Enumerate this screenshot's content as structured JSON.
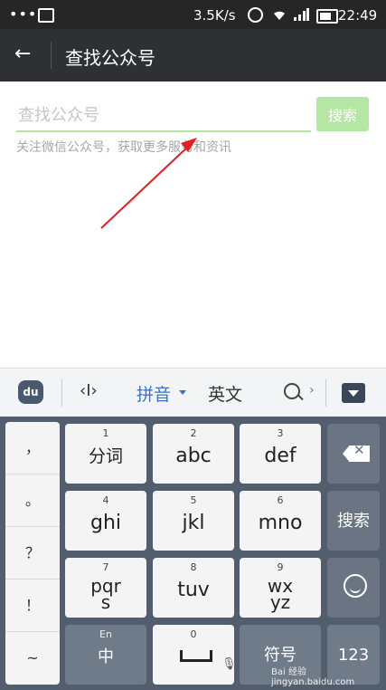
{
  "status_bar": {
    "dots": "•••",
    "speed": "3.5K/s",
    "time": "22:49"
  },
  "app_bar": {
    "back_icon": "←",
    "title": "查找公众号"
  },
  "search": {
    "placeholder": "查找公众号",
    "button_label": "搜索",
    "hint": "关注微信公众号，获取更多服务和资讯",
    "accent_color": "#b4e6a4"
  },
  "ime_toolbar": {
    "logo": "du",
    "cursor_icon": "‹I›",
    "pinyin_label": "拼音",
    "english_label": "英文",
    "more_icon": "›"
  },
  "keyboard": {
    "punctuation": [
      "，",
      "。",
      "？",
      "！",
      "~"
    ],
    "keys": [
      {
        "num": "1",
        "label": "分词"
      },
      {
        "num": "2",
        "label": "abc"
      },
      {
        "num": "3",
        "label": "def"
      },
      {
        "num": "4",
        "label": "ghi"
      },
      {
        "num": "5",
        "label": "jkl"
      },
      {
        "num": "6",
        "label": "mno"
      },
      {
        "num": "7",
        "label": "pqrs"
      },
      {
        "num": "8",
        "label": "tuv"
      },
      {
        "num": "9",
        "label": "wxyz"
      }
    ],
    "search_key": "搜索",
    "lang_key_top": "En",
    "lang_key_bottom": "中",
    "space_num": "0",
    "symbol_key": "符号",
    "num_key": "123"
  },
  "watermark": "Bai 经验 jingyan.baidu.com"
}
